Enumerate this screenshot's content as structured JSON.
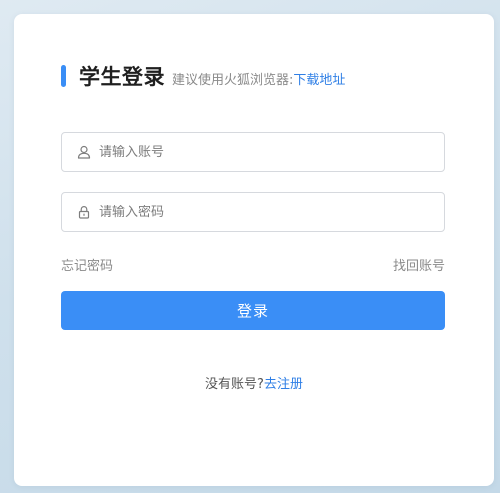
{
  "header": {
    "title": "学生登录",
    "hint": "建议使用火狐浏览器:",
    "download_link": "下载地址"
  },
  "form": {
    "username": {
      "placeholder": "请输入账号",
      "value": "",
      "icon": "user-icon"
    },
    "password": {
      "placeholder": "请输入密码",
      "value": "",
      "icon": "lock-icon"
    }
  },
  "links": {
    "forgot_password": "忘记密码",
    "retrieve_account": "找回账号"
  },
  "login_button": "登录",
  "register": {
    "question": "没有账号?",
    "link": "去注册"
  },
  "colors": {
    "accent": "#3a8ef6",
    "link": "#2f7fe6",
    "background": "#cfe0ec"
  }
}
